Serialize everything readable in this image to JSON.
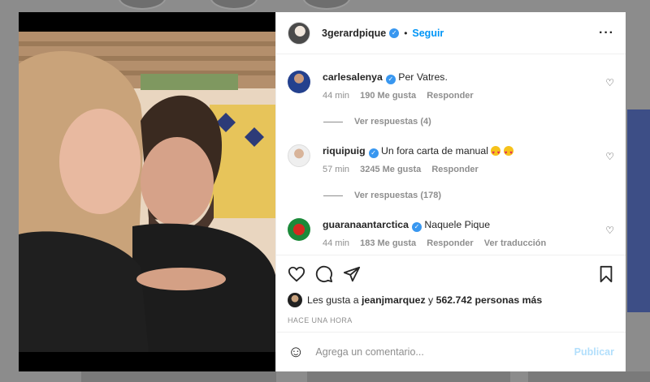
{
  "post": {
    "author": "3gerardpique",
    "follow_label": "Seguir",
    "separator": "•"
  },
  "comments": [
    {
      "user": "carlesalenya",
      "text": "Per Vatres.",
      "time": "44 min",
      "likes": "190 Me gusta",
      "reply_label": "Responder",
      "replies_label": "Ver respuestas (4)"
    },
    {
      "user": "riquipuig",
      "text": "Un fora carta de manual",
      "time": "57 min",
      "likes": "3245 Me gusta",
      "reply_label": "Responder",
      "replies_label": "Ver respuestas (178)"
    },
    {
      "user": "guaranaantarctica",
      "text": "Naquele Pique",
      "time": "44 min",
      "likes": "183 Me gusta",
      "reply_label": "Responder",
      "translate_label": "Ver traducción"
    }
  ],
  "likes_line": {
    "prefix": "Les gusta a",
    "user": "jeanjmarquez",
    "joiner": "y",
    "count": "562.742 personas más"
  },
  "posted_time": "HACE UNA HORA",
  "comment_box": {
    "placeholder": "Agrega un comentario...",
    "publish_label": "Publicar"
  },
  "icons": {
    "more": "more-options-icon",
    "verified": "verified-badge-icon",
    "heart": "heart-icon",
    "comment": "comment-icon",
    "share": "share-icon",
    "save": "bookmark-icon",
    "emoji": "emoji-icon"
  },
  "colors": {
    "accent": "#0095f6",
    "verified": "#3897f0",
    "publish_disabled": "#b2dffc"
  }
}
